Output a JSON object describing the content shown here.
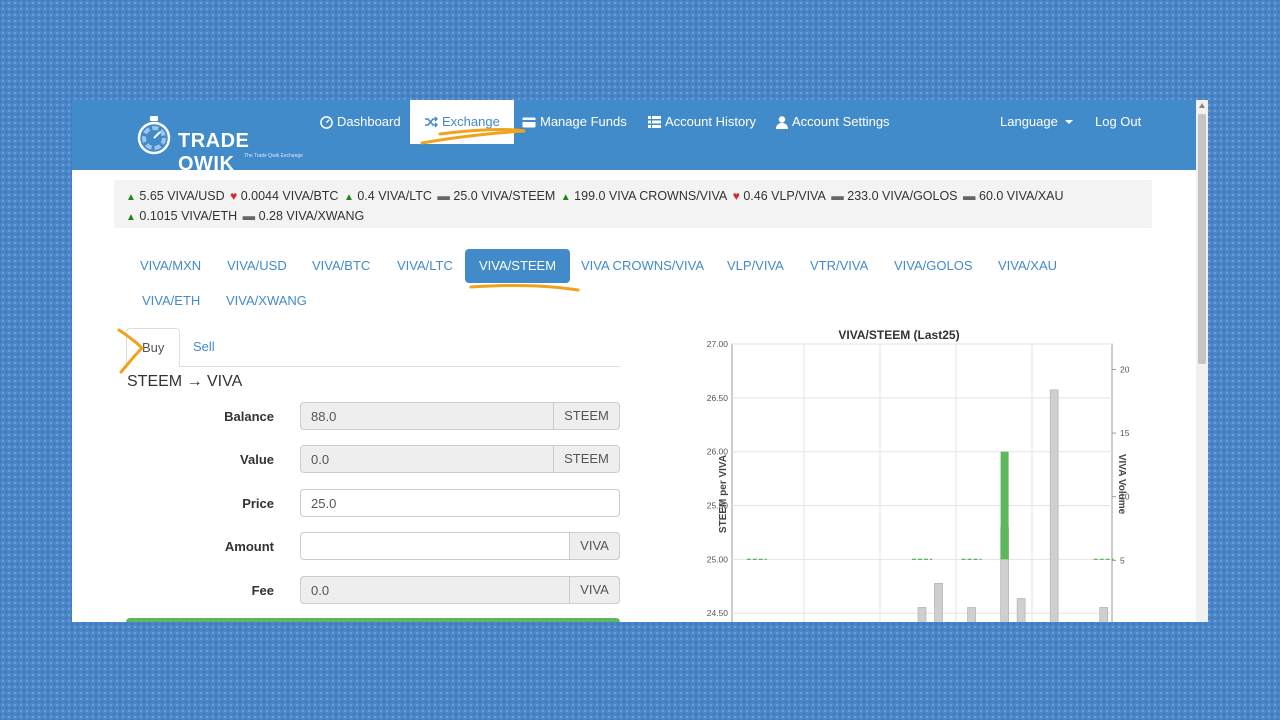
{
  "app": {
    "logo_text": "TRADE QWIK",
    "logo_tagline": "The Trade Qwik Exchange"
  },
  "nav": {
    "dashboard": "Dashboard",
    "exchange": "Exchange",
    "manage_funds": "Manage Funds",
    "account_history": "Account History",
    "account_settings": "Account Settings",
    "language": "Language",
    "logout": "Log Out"
  },
  "ticker": [
    {
      "dir": "up",
      "text": "5.65 VIVA/USD"
    },
    {
      "dir": "down",
      "text": "0.0044 VIVA/BTC"
    },
    {
      "dir": "up",
      "text": "0.4 VIVA/LTC"
    },
    {
      "dir": "flat",
      "text": "25.0 VIVA/STEEM"
    },
    {
      "dir": "up",
      "text": "199.0 VIVA CROWNS/VIVA"
    },
    {
      "dir": "down",
      "text": "0.46 VLP/VIVA"
    },
    {
      "dir": "flat",
      "text": "233.0 VIVA/GOLOS"
    },
    {
      "dir": "flat",
      "text": "60.0 VIVA/XAU"
    },
    {
      "dir": "up",
      "text": "0.1015 VIVA/ETH"
    },
    {
      "dir": "flat",
      "text": "0.28 VIVA/XWANG"
    }
  ],
  "markets": [
    "VIVA/MXN",
    "VIVA/USD",
    "VIVA/BTC",
    "VIVA/LTC",
    "VIVA/STEEM",
    "VIVA CROWNS/VIVA",
    "VLP/VIVA",
    "VTR/VIVA",
    "VIVA/GOLOS",
    "VIVA/XAU",
    "VIVA/ETH",
    "VIVA/XWANG"
  ],
  "active_market": "VIVA/STEEM",
  "trade": {
    "tab_buy": "Buy",
    "tab_sell": "Sell",
    "pair_title": "STEEM → VIVA",
    "balance_label": "Balance",
    "balance_value": "88.0",
    "balance_unit": "STEEM",
    "value_label": "Value",
    "value_value": "0.0",
    "value_unit": "STEEM",
    "price_label": "Price",
    "price_value": "25.0",
    "amount_label": "Amount",
    "amount_value": "",
    "amount_unit": "VIVA",
    "fee_label": "Fee",
    "fee_value": "0.0",
    "fee_unit": "VIVA"
  },
  "chart_data": {
    "type": "bar",
    "title": "VIVA/STEEM (Last25)",
    "ylabel": "STEEM per VIVA",
    "y2label": "VIVA Volume",
    "ylim": [
      24.4,
      27.0
    ],
    "y_ticks": [
      "27.00",
      "26.50",
      "26.00",
      "25.50",
      "25.00",
      "24.50"
    ],
    "y2lim": [
      0,
      22
    ],
    "y2_ticks": [
      "20",
      "15",
      "10",
      "5"
    ],
    "grid": true,
    "colors": {
      "volume": "#cfcfcf",
      "price_up": "#5cb85c"
    },
    "volume_bars": [
      {
        "slot": 11,
        "volume": 1.3
      },
      {
        "slot": 12,
        "volume": 3.2
      },
      {
        "slot": 14,
        "volume": 1.3
      },
      {
        "slot": 16,
        "volume": 7.6
      },
      {
        "slot": 17,
        "volume": 2.0
      },
      {
        "slot": 19,
        "volume": 18.4
      },
      {
        "slot": 22,
        "volume": 1.3
      }
    ],
    "price_marks": [
      {
        "slot": 1,
        "open": 25.0,
        "close": 25.0
      },
      {
        "slot": 11,
        "open": 25.0,
        "close": 25.0
      },
      {
        "slot": 14,
        "open": 25.0,
        "close": 25.0
      },
      {
        "slot": 16,
        "open": 25.0,
        "close": 26.0
      },
      {
        "slot": 22,
        "open": 25.0,
        "close": 25.0
      }
    ],
    "slots": 23
  }
}
